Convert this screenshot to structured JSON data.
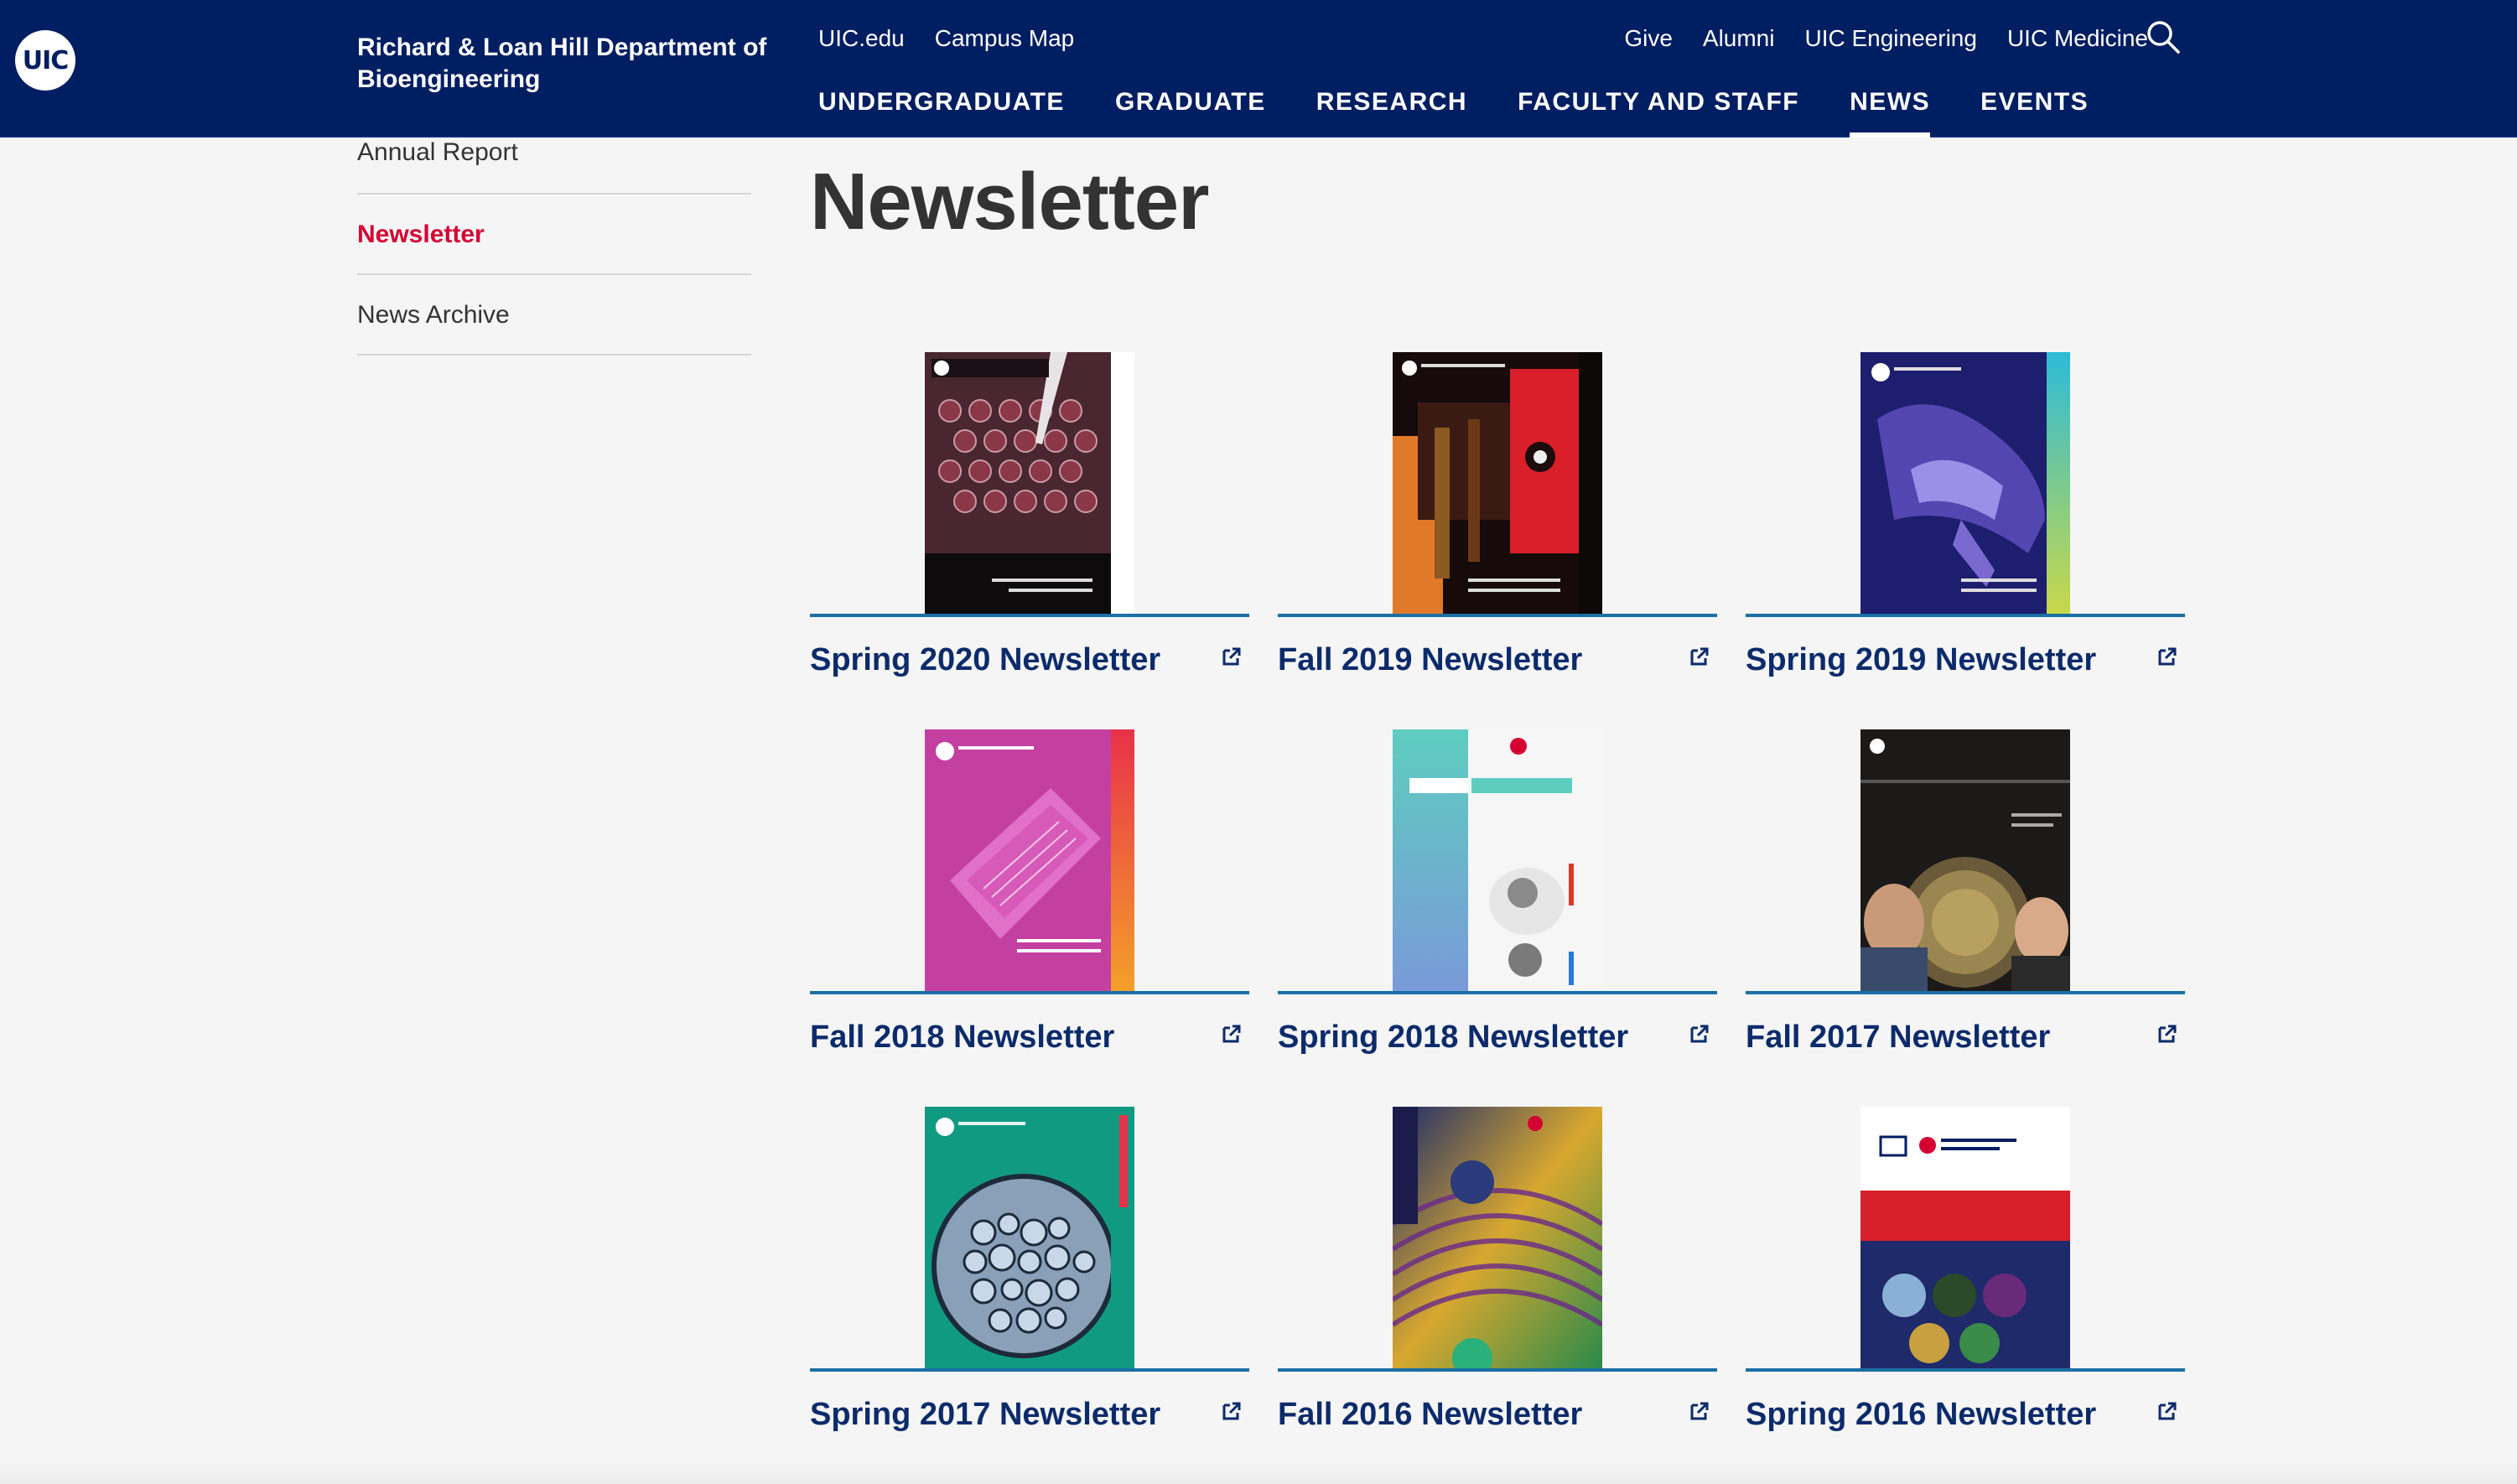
{
  "brand": {
    "logo_text": "UIC",
    "department": "Richard & Loan Hill Department of Bioengineering"
  },
  "utility_nav": {
    "left": [
      "UIC.edu",
      "Campus Map"
    ],
    "right": [
      "Give",
      "Alumni",
      "UIC Engineering",
      "UIC Medicine"
    ]
  },
  "main_nav": {
    "items": [
      "UNDERGRADUATE",
      "GRADUATE",
      "RESEARCH",
      "FACULTY AND STAFF",
      "NEWS",
      "EVENTS"
    ],
    "active": "NEWS"
  },
  "sidebar": {
    "items": [
      "Annual Report",
      "Newsletter",
      "News Archive"
    ],
    "active": "Newsletter"
  },
  "page": {
    "title": "Newsletter"
  },
  "newsletters": [
    {
      "title": "Spring 2020 Newsletter",
      "cover": "spring-2020"
    },
    {
      "title": "Fall 2019 Newsletter",
      "cover": "fall-2019"
    },
    {
      "title": "Spring 2019 Newsletter",
      "cover": "spring-2019"
    },
    {
      "title": "Fall 2018 Newsletter",
      "cover": "fall-2018"
    },
    {
      "title": "Spring 2018 Newsletter",
      "cover": "spring-2018"
    },
    {
      "title": "Fall 2017 Newsletter",
      "cover": "fall-2017"
    },
    {
      "title": "Spring 2017 Newsletter",
      "cover": "spring-2017"
    },
    {
      "title": "Fall 2016 Newsletter",
      "cover": "fall-2016"
    },
    {
      "title": "Spring 2016 Newsletter",
      "cover": "spring-2016"
    }
  ],
  "colors": {
    "header_bg": "#001e62",
    "active_side": "#d50032",
    "card_title": "#0c2b6b",
    "card_rule": "#1a6fa5"
  },
  "icons": {
    "search": "search-icon",
    "external": "external-link-icon"
  }
}
